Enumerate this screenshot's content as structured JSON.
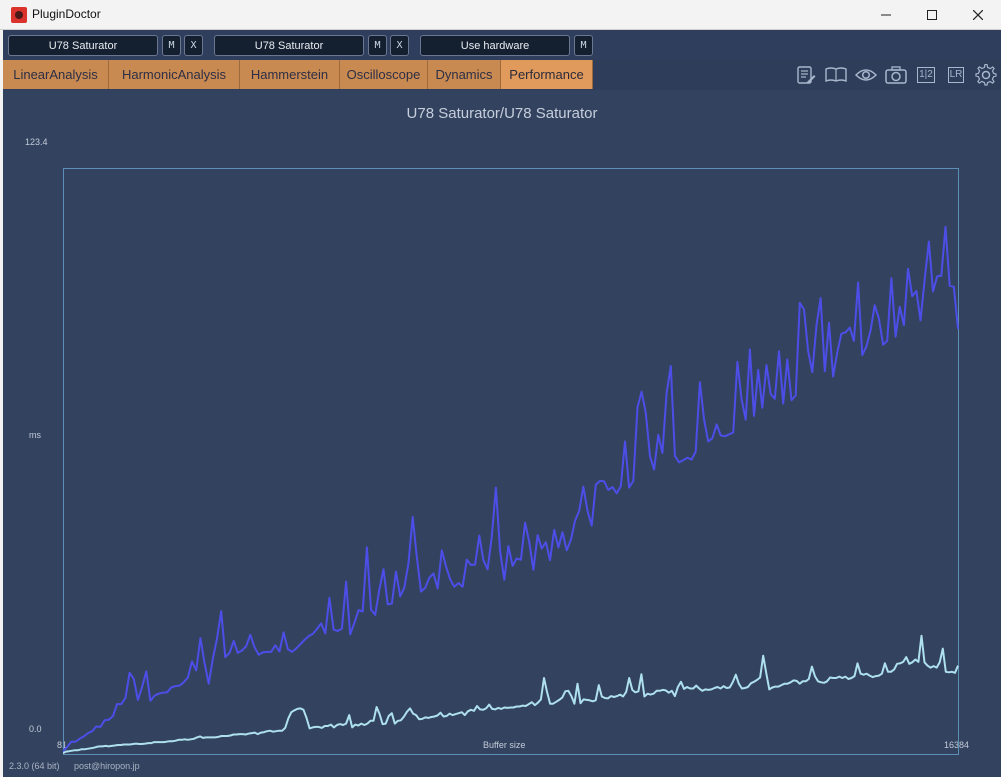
{
  "window": {
    "title": "PluginDoctor",
    "minimize_icon": "minimize-icon",
    "maximize_icon": "maximize-icon",
    "close_icon": "close-icon"
  },
  "toolbar": {
    "plugin_a": "U78 Saturator",
    "plugin_b": "U78 Saturator",
    "hardware": "Use hardware",
    "m_label": "M",
    "x_label": "X"
  },
  "tabs": [
    "LinearAnalysis",
    "HarmonicAnalysis",
    "Hammerstein",
    "Oscilloscope",
    "Dynamics",
    "Performance"
  ],
  "active_tab": "Performance",
  "tools": {
    "notes": "notes-edit-icon",
    "book": "book-icon",
    "eye": "eye-icon",
    "camera": "camera-icon",
    "half_label": "1|2",
    "lr_label": "LR",
    "gear": "gear-icon"
  },
  "footer": {
    "version": "2.3.0 (64 bit)",
    "email": "post@hiropon.jp"
  },
  "colors": {
    "series_a": "#4d4ee8",
    "series_b": "#aee0ee",
    "tab_active": "#e09a5c",
    "tab": "#c98a52",
    "background": "#33435f"
  },
  "chart_data": {
    "type": "line",
    "title": "U78 Saturator/U78 Saturator",
    "xlabel": "Buffer size",
    "ylabel": "ms",
    "xlim": [
      81,
      16384
    ],
    "ylim": [
      0.0,
      123.4
    ],
    "x_tick_labels": [
      "81",
      "16384"
    ],
    "y_tick_labels": [
      "0.0",
      "123.4"
    ],
    "grid": false,
    "series": [
      {
        "values": [
          0.6,
          1.5,
          2.6,
          2.6,
          3.2,
          3.7,
          4.4,
          4.8,
          5.8,
          5.7,
          7.1,
          7.2,
          8.0,
          10.5,
          10.5,
          11.8,
          17.1,
          15.8,
          11.4,
          14.1,
          17.4,
          11.2,
          12.3,
          12.7,
          12.9,
          13.0,
          14.0,
          14.3,
          14.4,
          15.1,
          16.1,
          19.5,
          17.6,
          24.4,
          19.2,
          14.8,
          20.1,
          24.3,
          30.1,
          20.4,
          21.3,
          23.8,
          21.3,
          21.8,
          22.7,
          25.1,
          22.5,
          20.9,
          21.4,
          21.5,
          21.5,
          22.9,
          21.6,
          25.6,
          22.1,
          21.5,
          22.2,
          23.1,
          24.0,
          24.8,
          25.3,
          26.3,
          27.5,
          25.4,
          32.9,
          26.2,
          25.9,
          26.4,
          36.3,
          25.2,
          27.6,
          30.3,
          30.0,
          43.5,
          30.4,
          29.3,
          34.7,
          38.9,
          31.5,
          31.7,
          38.4,
          33.2,
          35.0,
          40.2,
          49.9,
          41.5,
          34.2,
          35.0,
          37.1,
          38.0,
          34.9,
          42.9,
          39.5,
          36.8,
          35.2,
          36.0,
          35.2,
          40.9,
          39.8,
          39.9,
          46.0,
          40.8,
          38.9,
          45.8,
          56.1,
          42.7,
          36.7,
          43.8,
          39.6,
          41.2,
          40.9,
          48.7,
          44.7,
          38.8,
          46.1,
          43.3,
          44.6,
          40.8,
          47.2,
          43.5,
          46.7,
          42.9,
          45.1,
          49.1,
          51.2,
          56.3,
          51.2,
          48.1,
          56.7,
          57.5,
          57.4,
          55.6,
          56.2,
          54.9,
          56.4,
          65.8,
          56.1,
          57.5,
          73.0,
          76.3,
          71.8,
          62.7,
          59.9,
          67.2,
          63.4,
          76.0,
          81.7,
          62.8,
          61.4,
          61.9,
          62.4,
          62.0,
          63.7,
          78.3,
          70.4,
          65.8,
          66.5,
          69.4,
          67.1,
          66.9,
          67.3,
          67.7,
          82.6,
          74.8,
          70.4,
          85.2,
          71.2,
          80.9,
          72.9,
          81.9,
          75.8,
          74.8,
          84.8,
          73.8,
          83.1,
          74.5,
          75.5,
          95.0,
          93.6,
          84.9,
          80.4,
          90.3,
          96.0,
          80.6,
          90.8,
          79.5,
          84.6,
          88.5,
          88.8,
          89.8,
          87.0,
          99.3,
          84.0,
          85.8,
          89.2,
          94.5,
          91.7,
          86.2,
          87.0,
          100.2,
          87.9,
          94.2,
          90.3,
          102.2,
          96.4,
          97.5,
          91.3,
          100.0,
          107.9,
          97.4,
          100.6,
          100.7,
          111.0,
          98.6,
          98.4,
          89.5
        ]
      },
      {
        "values": [
          0.2,
          0.5,
          0.6,
          0.7,
          0.8,
          0.8,
          1.0,
          1.0,
          1.1,
          1.2,
          1.3,
          1.5,
          1.6,
          1.6,
          1.7,
          1.6,
          1.7,
          1.8,
          1.9,
          1.9,
          2.0,
          2.0,
          2.0,
          2.1,
          2.2,
          2.1,
          2.1,
          2.2,
          2.3,
          2.3,
          2.5,
          2.5,
          2.5,
          2.5,
          2.6,
          2.7,
          2.7,
          2.8,
          3.0,
          3.0,
          3.1,
          3.0,
          3.1,
          3.2,
          3.5,
          3.7,
          3.4,
          3.5,
          3.5,
          3.5,
          3.5,
          3.6,
          3.8,
          3.8,
          3.8,
          3.9,
          4.1,
          4.1,
          4.2,
          4.2,
          4.1,
          4.3,
          4.4,
          4.5,
          4.2,
          4.5,
          4.6,
          4.8,
          4.9,
          4.7,
          4.8,
          4.9,
          4.9,
          5.5,
          7.5,
          8.8,
          9.2,
          9.5,
          9.6,
          9.3,
          7.6,
          5.4,
          5.6,
          5.7,
          5.7,
          5.5,
          5.9,
          5.9,
          6.2,
          5.6,
          6.1,
          6.3,
          6.1,
          6.4,
          8.2,
          5.6,
          6.2,
          6.0,
          6.4,
          6.1,
          6.4,
          7.0,
          7.0,
          9.9,
          8.4,
          6.3,
          6.4,
          8.0,
          8.6,
          6.4,
          7.0,
          7.1,
          7.9,
          8.9,
          9.6,
          8.5,
          8.2,
          7.3,
          7.4,
          7.7,
          7.6,
          7.8,
          7.9,
          8.1,
          8.7,
          7.9,
          8.0,
          8.5,
          8.2,
          8.4,
          8.6,
          8.8,
          8.2,
          9.0,
          9.3,
          9.1,
          10.1,
          9.4,
          9.3,
          9.6,
          10.4,
          9.5,
          9.4,
          9.7,
          9.5,
          9.8,
          9.7,
          9.8,
          9.8,
          10.0,
          10.0,
          10.2,
          10.1,
          10.5,
          10.9,
          10.3,
          10.8,
          11.5,
          16.0,
          13.1,
          10.6,
          10.6,
          11.0,
          11.4,
          11.9,
          13.2,
          13.3,
          12.2,
          10.6,
          14.8,
          10.7,
          11.5,
          11.4,
          11.3,
          11.1,
          11.3,
          14.5,
          12.1,
          11.8,
          11.7,
          12.2,
          12.0,
          12.2,
          12.5,
          12.1,
          13.1,
          16.0,
          13.5,
          13.0,
          13.2,
          16.8,
          12.1,
          12.7,
          12.5,
          12.7,
          13.3,
          13.3,
          13.5,
          13.4,
          12.9,
          13.3,
          12.2,
          14.1,
          15.2,
          13.7,
          14.1,
          13.8,
          13.8,
          14.4,
          13.8,
          13.3,
          13.6,
          13.5,
          13.6,
          13.9,
          14.1,
          13.8,
          14.3,
          13.9,
          14.0,
          15.1,
          16.7,
          14.8,
          13.8,
          13.9,
          14.1,
          14.9,
          15.2,
          15.6,
          16.1,
          20.7,
          17.1,
          13.6,
          14.0,
          14.2,
          14.2,
          14.5,
          14.8,
          14.8,
          15.1,
          15.5,
          15.4,
          14.8,
          15.3,
          15.3,
          15.8,
          18.4,
          16.4,
          15.3,
          15.1,
          15.0,
          15.3,
          16.1,
          16.0,
          16.0,
          16.3,
          16.0,
          16.3,
          15.8,
          16.0,
          16.4,
          19.1,
          16.9,
          16.7,
          16.9,
          16.5,
          16.2,
          16.4,
          16.5,
          16.9,
          19.1,
          17.3,
          17.3,
          17.8,
          19.0,
          19.1,
          19.4,
          20.4,
          19.0,
          19.3,
          19.9,
          19.4,
          24.9,
          19.3,
          18.6,
          18.2,
          18.5,
          18.2,
          19.3,
          22.2,
          17.3,
          17.2,
          17.3,
          17.1,
          18.6
        ]
      }
    ]
  }
}
